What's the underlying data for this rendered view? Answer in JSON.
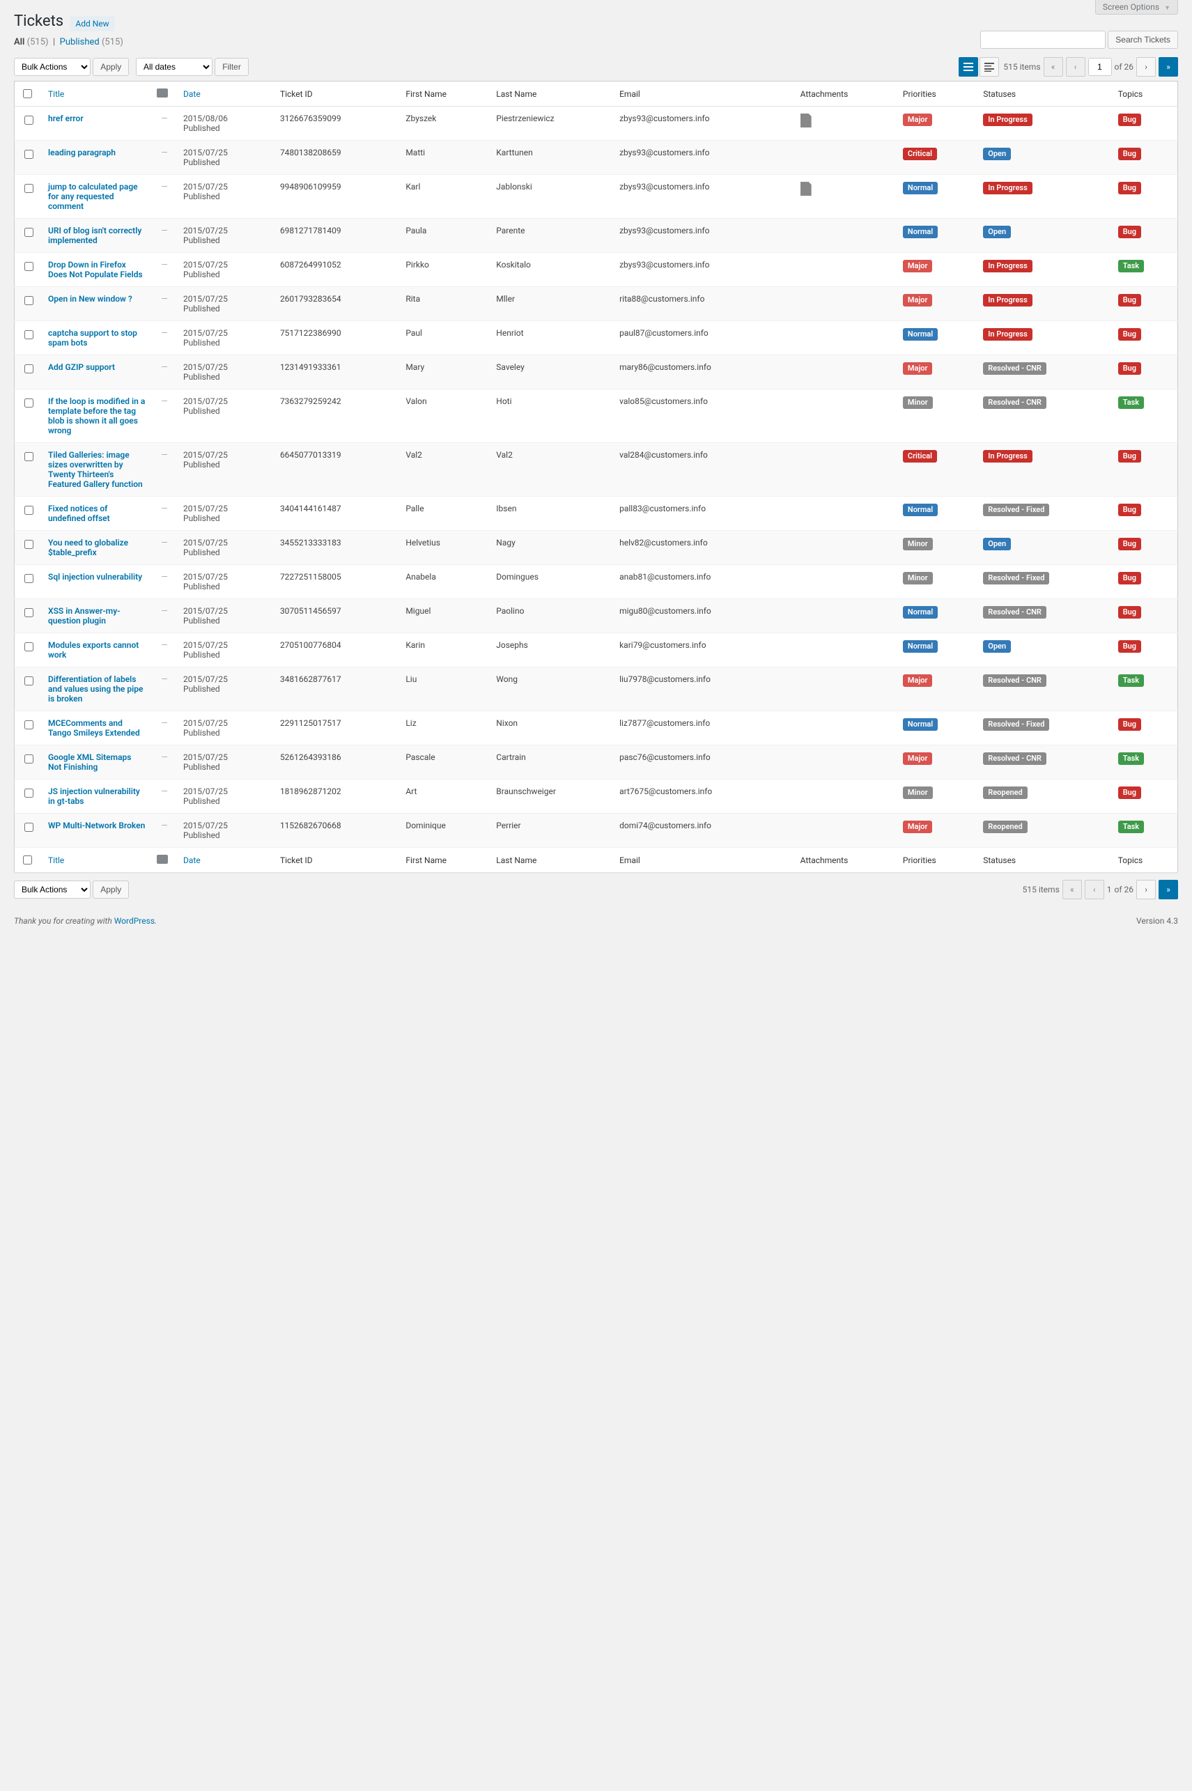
{
  "screen_options_label": "Screen Options",
  "page_title": "Tickets",
  "add_new": "Add New",
  "filters": {
    "all_label": "All",
    "all_count": "(515)",
    "published_label": "Published",
    "published_count": "(515)"
  },
  "bulk_actions_label": "Bulk Actions",
  "apply_label": "Apply",
  "dates_label": "All dates",
  "filter_label": "Filter",
  "search_button": "Search Tickets",
  "items_count": "515 items",
  "page_current": "1",
  "page_of": "of 26",
  "cols": {
    "title": "Title",
    "date": "Date",
    "ticket_id": "Ticket ID",
    "first": "First Name",
    "last": "Last Name",
    "email": "Email",
    "attach": "Attachments",
    "priority": "Priorities",
    "status": "Statuses",
    "topic": "Topics"
  },
  "priority_map": {
    "Critical": "b-critical",
    "Major": "b-major",
    "Normal": "b-normal",
    "Minor": "b-minor"
  },
  "status_map": {
    "Open": "b-open",
    "In Progress": "b-inprogress",
    "Resolved - CNR": "b-resolved",
    "Resolved - Fixed": "b-resolved",
    "Reopened": "b-reopened"
  },
  "topic_map": {
    "Bug": "b-bug",
    "Task": "b-task"
  },
  "rows": [
    {
      "title": "href error",
      "date": "2015/08/06",
      "state": "Published",
      "tid": "3126676359099",
      "first": "Zbyszek",
      "last": "Piestrzeniewicz",
      "email": "zbys93@customers.info",
      "attach": true,
      "priority": "Major",
      "status": "In Progress",
      "topic": "Bug"
    },
    {
      "title": "leading paragraph",
      "date": "2015/07/25",
      "state": "Published",
      "tid": "7480138208659",
      "first": "Matti",
      "last": "Karttunen",
      "email": "zbys93@customers.info",
      "attach": false,
      "priority": "Critical",
      "status": "Open",
      "topic": "Bug"
    },
    {
      "title": "jump to calculated page for any requested comment",
      "date": "2015/07/25",
      "state": "Published",
      "tid": "9948906109959",
      "first": "Karl",
      "last": "Jablonski",
      "email": "zbys93@customers.info",
      "attach": true,
      "priority": "Normal",
      "status": "In Progress",
      "topic": "Bug"
    },
    {
      "title": "URI of blog isn't correctly implemented",
      "date": "2015/07/25",
      "state": "Published",
      "tid": "6981271781409",
      "first": "Paula",
      "last": "Parente",
      "email": "zbys93@customers.info",
      "attach": false,
      "priority": "Normal",
      "status": "Open",
      "topic": "Bug"
    },
    {
      "title": "Drop Down in Firefox Does Not Populate Fields",
      "date": "2015/07/25",
      "state": "Published",
      "tid": "6087264991052",
      "first": "Pirkko",
      "last": "Koskitalo",
      "email": "zbys93@customers.info",
      "attach": false,
      "priority": "Major",
      "status": "In Progress",
      "topic": "Task"
    },
    {
      "title": "Open in New window ?",
      "date": "2015/07/25",
      "state": "Published",
      "tid": "2601793283654",
      "first": "Rita",
      "last": "Mller",
      "email": "rita88@customers.info",
      "attach": false,
      "priority": "Major",
      "status": "In Progress",
      "topic": "Bug"
    },
    {
      "title": "captcha support to stop spam bots",
      "date": "2015/07/25",
      "state": "Published",
      "tid": "7517122386990",
      "first": "Paul",
      "last": "Henriot",
      "email": "paul87@customers.info",
      "attach": false,
      "priority": "Normal",
      "status": "In Progress",
      "topic": "Bug"
    },
    {
      "title": "Add GZIP support",
      "date": "2015/07/25",
      "state": "Published",
      "tid": "1231491933361",
      "first": "Mary",
      "last": "Saveley",
      "email": "mary86@customers.info",
      "attach": false,
      "priority": "Major",
      "status": "Resolved - CNR",
      "topic": "Bug"
    },
    {
      "title": "If the loop is modified in a template before the tag blob is shown it all goes wrong",
      "date": "2015/07/25",
      "state": "Published",
      "tid": "7363279259242",
      "first": "Valon",
      "last": "Hoti",
      "email": "valo85@customers.info",
      "attach": false,
      "priority": "Minor",
      "status": "Resolved - CNR",
      "topic": "Task"
    },
    {
      "title": "Tiled Galleries: image sizes overwritten by Twenty Thirteen's Featured Gallery function",
      "date": "2015/07/25",
      "state": "Published",
      "tid": "6645077013319",
      "first": "Val2",
      "last": "Val2",
      "email": "val284@customers.info",
      "attach": false,
      "priority": "Critical",
      "status": "In Progress",
      "topic": "Bug"
    },
    {
      "title": "Fixed notices of undefined offset",
      "date": "2015/07/25",
      "state": "Published",
      "tid": "3404144161487",
      "first": "Palle",
      "last": "Ibsen",
      "email": "pall83@customers.info",
      "attach": false,
      "priority": "Normal",
      "status": "Resolved - Fixed",
      "topic": "Bug"
    },
    {
      "title": "You need to globalize $table_prefix",
      "date": "2015/07/25",
      "state": "Published",
      "tid": "3455213333183",
      "first": "Helvetius",
      "last": "Nagy",
      "email": "helv82@customers.info",
      "attach": false,
      "priority": "Minor",
      "status": "Open",
      "topic": "Bug"
    },
    {
      "title": "Sql injection vulnerability",
      "date": "2015/07/25",
      "state": "Published",
      "tid": "7227251158005",
      "first": "Anabela",
      "last": "Domingues",
      "email": "anab81@customers.info",
      "attach": false,
      "priority": "Minor",
      "status": "Resolved - Fixed",
      "topic": "Bug"
    },
    {
      "title": "XSS in Answer-my-question plugin",
      "date": "2015/07/25",
      "state": "Published",
      "tid": "3070511456597",
      "first": "Miguel",
      "last": "Paolino",
      "email": "migu80@customers.info",
      "attach": false,
      "priority": "Normal",
      "status": "Resolved - CNR",
      "topic": "Bug"
    },
    {
      "title": "Modules exports cannot work",
      "date": "2015/07/25",
      "state": "Published",
      "tid": "2705100776804",
      "first": "Karin",
      "last": "Josephs",
      "email": "kari79@customers.info",
      "attach": false,
      "priority": "Normal",
      "status": "Open",
      "topic": "Bug"
    },
    {
      "title": "Differentiation of labels and values using the pipe is broken",
      "date": "2015/07/25",
      "state": "Published",
      "tid": "3481662877617",
      "first": "Liu",
      "last": "Wong",
      "email": "liu7978@customers.info",
      "attach": false,
      "priority": "Major",
      "status": "Resolved - CNR",
      "topic": "Task"
    },
    {
      "title": "MCEComments and Tango Smileys Extended",
      "date": "2015/07/25",
      "state": "Published",
      "tid": "2291125017517",
      "first": "Liz",
      "last": "Nixon",
      "email": "liz7877@customers.info",
      "attach": false,
      "priority": "Normal",
      "status": "Resolved - Fixed",
      "topic": "Bug"
    },
    {
      "title": "Google XML Sitemaps Not Finishing",
      "date": "2015/07/25",
      "state": "Published",
      "tid": "5261264393186",
      "first": "Pascale",
      "last": "Cartrain",
      "email": "pasc76@customers.info",
      "attach": false,
      "priority": "Major",
      "status": "Resolved - CNR",
      "topic": "Task"
    },
    {
      "title": "JS injection vulnerability in gt-tabs",
      "date": "2015/07/25",
      "state": "Published",
      "tid": "1818962871202",
      "first": "Art",
      "last": "Braunschweiger",
      "email": "art7675@customers.info",
      "attach": false,
      "priority": "Minor",
      "status": "Reopened",
      "topic": "Bug"
    },
    {
      "title": "WP Multi-Network Broken",
      "date": "2015/07/25",
      "state": "Published",
      "tid": "1152682670668",
      "first": "Dominique",
      "last": "Perrier",
      "email": "domi74@customers.info",
      "attach": false,
      "priority": "Major",
      "status": "Reopened",
      "topic": "Task"
    }
  ],
  "footer": {
    "text": "Thank you for creating with ",
    "link": "WordPress",
    "period": ".",
    "version": "Version 4.3"
  }
}
